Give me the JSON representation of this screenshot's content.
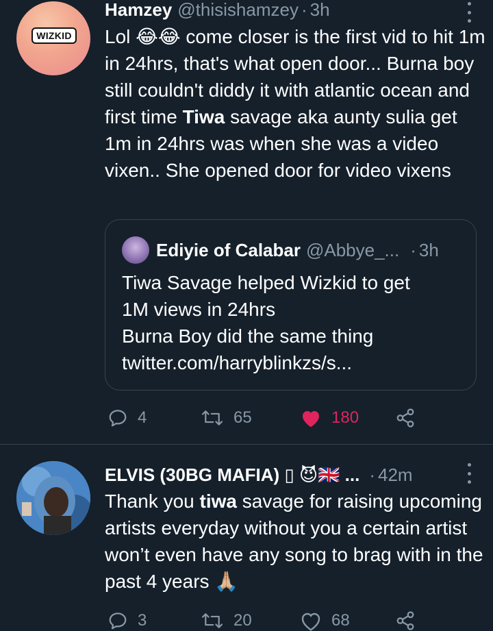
{
  "tweets": [
    {
      "avatar_text": "WIZKID",
      "name": "Hamzey",
      "handle": "@thisishamzey",
      "separator": "·",
      "time": "3h",
      "body_prefix": "Lol 😂😂 come closer is the first vid to hit 1m in 24hrs, that's what open door... Burna boy still couldn't diddy it with atlantic ocean and first time ",
      "body_bold": "Tiwa",
      "body_suffix": " savage aka aunty sulia get 1m in 24hrs was when she was a video vixen.. She opened door for video vixens",
      "quote": {
        "name": "Ediyie of Calabar",
        "handle": "@Abbye_...",
        "separator": "·",
        "time": "3h",
        "text": "Tiwa Savage helped Wizkid to get\n1M views in 24hrs\nBurna Boy did the same thing\ntwitter.com/harryblinkzs/s..."
      },
      "replies": "4",
      "retweets": "65",
      "likes": "180",
      "liked": true
    },
    {
      "name": "ELVIS (30BG MAFIA) ▯ 😈🇬🇧 ...",
      "separator": "·",
      "time": "42m",
      "body_prefix": "Thank you ",
      "body_bold": "tiwa",
      "body_suffix": " savage for raising upcoming artists everyday  without you a certain artist won’t even have any song to brag with in the past 4 years 🙏🏼",
      "replies": "3",
      "retweets": "20",
      "likes": "68",
      "liked": false
    }
  ],
  "colors": {
    "background": "#15202b",
    "secondary_text": "#8899a6",
    "like_active": "#e0245e",
    "divider": "#38444d"
  },
  "icons": [
    "reply-icon",
    "retweet-icon",
    "like-icon",
    "share-icon",
    "more-icon"
  ]
}
